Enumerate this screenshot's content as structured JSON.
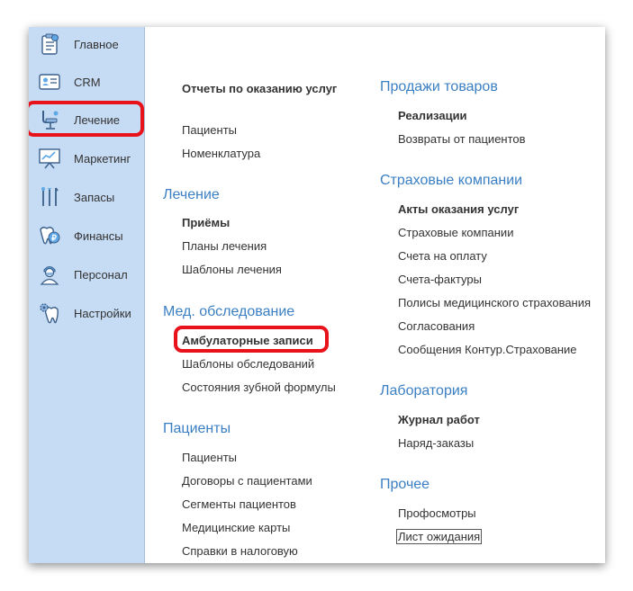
{
  "sidebar": {
    "items": [
      {
        "label": "Главное",
        "icon": "clipboard-icon"
      },
      {
        "label": "CRM",
        "icon": "id-card-icon"
      },
      {
        "label": "Лечение",
        "icon": "dental-chair-icon"
      },
      {
        "label": "Маркетинг",
        "icon": "presentation-board-icon"
      },
      {
        "label": "Запасы",
        "icon": "dental-tools-icon"
      },
      {
        "label": "Финансы",
        "icon": "tooth-coin-icon"
      },
      {
        "label": "Персонал",
        "icon": "doctor-icon"
      },
      {
        "label": "Настройки",
        "icon": "tooth-gear-icon"
      }
    ],
    "active_index": 2,
    "highlight_color": "#e8121a"
  },
  "left_column": {
    "top_links": [
      "Отчеты по оказанию услуг",
      "Пациенты",
      "Номенклатура"
    ],
    "treatment": {
      "title": "Лечение",
      "links": [
        "Приёмы",
        "Планы лечения",
        "Шаблоны лечения"
      ]
    },
    "exam": {
      "title": "Мед. обследование",
      "links": [
        "Амбулаторные записи",
        "Шаблоны обследований",
        "Состояния зубной формулы"
      ]
    },
    "patients": {
      "title": "Пациенты",
      "links": [
        "Пациенты",
        "Договоры с пациентами",
        "Сегменты пациентов",
        "Медицинские карты",
        "Справки в налоговую"
      ]
    }
  },
  "right_column": {
    "sales": {
      "title": "Продажи товаров",
      "links": [
        "Реализации",
        "Возвраты от пациентов"
      ]
    },
    "insurance": {
      "title": "Страховые компании",
      "links": [
        "Акты оказания услуг",
        "Страховые компании",
        "Счета на оплату",
        "Счета-фактуры",
        "Полисы медицинского страхования",
        "Согласования",
        "Сообщения Контур.Страхование"
      ]
    },
    "lab": {
      "title": "Лаборатория",
      "links": [
        "Журнал работ",
        "Наряд-заказы"
      ]
    },
    "other": {
      "title": "Прочее",
      "links": [
        "Профосмотры",
        "Лист ожидания"
      ]
    }
  },
  "colors": {
    "sidebar_bg": "#c6dbf4",
    "section_title": "#3a7fc3",
    "highlight": "#e8121a"
  }
}
